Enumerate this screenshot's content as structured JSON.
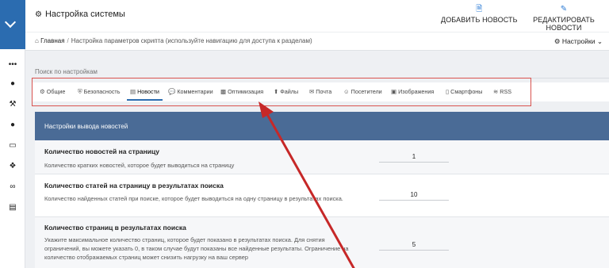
{
  "header": {
    "title": "Настройка системы",
    "add_news": "ДОБАВИТЬ НОВОСТЬ",
    "edit_news": "РЕДАКТИРОВАТЬ НОВОСТИ"
  },
  "breadcrumb": {
    "home": "Главная",
    "separator": "/",
    "current": "Настройка параметров скрипта (используйте навигацию для доступа к разделам)"
  },
  "settings_menu": {
    "label": "Настройки"
  },
  "search": {
    "placeholder": "Поиск по настройкам",
    "value": ""
  },
  "tabs": [
    {
      "label": "Общие",
      "icon": "gear-icon"
    },
    {
      "label": "Безопасность",
      "icon": "shield-icon"
    },
    {
      "label": "Новости",
      "icon": "document-icon",
      "active": true
    },
    {
      "label": "Комментарии",
      "icon": "comment-icon"
    },
    {
      "label": "Оптимизация",
      "icon": "chart-icon"
    },
    {
      "label": "Файлы",
      "icon": "upload-icon"
    },
    {
      "label": "Почта",
      "icon": "envelope-icon"
    },
    {
      "label": "Посетители",
      "icon": "user-circle-icon"
    },
    {
      "label": "Изображения",
      "icon": "image-icon"
    },
    {
      "label": "Смартфоны",
      "icon": "mobile-icon"
    },
    {
      "label": "RSS",
      "icon": "rss-icon"
    }
  ],
  "panel": {
    "title": "Настройки вывода новостей",
    "rows": [
      {
        "title": "Количество новостей на страницу",
        "desc": "Количество кратких новостей, которое будет выводиться на страницу",
        "value": "1"
      },
      {
        "title": "Количество статей на страницу в результатах поиска",
        "desc": "Количество найденных статей при поиске, которое будет выводиться на одну страницу в результатах поиска.",
        "value": "10"
      },
      {
        "title": "Количество страниц в результатах поиска",
        "desc": "Укажите максимальное количество страниц, которое будет показано в результатах поиска. Для снятия ограничений, вы можете указать 0, в таком случае будут показаны все найденные результаты. Ограничение на количество отображаемых страниц может снизить нагрузку на ваш сервер",
        "value": "5"
      }
    ]
  },
  "colors": {
    "accent": "#2b6cb0",
    "panel_header": "#4a6b96",
    "highlight": "#d9534f",
    "arrow": "#c62828"
  }
}
